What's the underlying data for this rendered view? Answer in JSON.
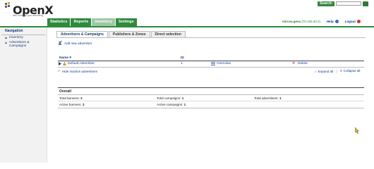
{
  "brand": {
    "name": "OpenX",
    "tagline": "take control of your advertising"
  },
  "search": {
    "label": "Search:",
    "placeholder": ""
  },
  "tabs": [
    {
      "label": "Statistics"
    },
    {
      "label": "Reports"
    },
    {
      "label": "Inventory"
    },
    {
      "label": "Settings"
    }
  ],
  "user": {
    "name": "mircea.gesu",
    "ip": "[70.150.40.2]",
    "help": "Help",
    "logout": "Logout"
  },
  "nav": {
    "title": "Navigation",
    "items": [
      {
        "label": "Inventory"
      },
      {
        "label": "Advertisers & Campaigns"
      }
    ]
  },
  "subtabs": [
    {
      "label": "Advertisers & Campaigns"
    },
    {
      "label": "Publishers & Zones"
    },
    {
      "label": "Direct selection"
    }
  ],
  "add_advertiser": "Add new advertiser",
  "table": {
    "col_name": "Name",
    "col_id": "ID",
    "rows": [
      {
        "name": "Default Advertiser",
        "id": "1",
        "overview": "Overview",
        "delete": "Delete"
      }
    ]
  },
  "hide_inactive": "Hide inactive advertisers",
  "expand_all": "Expand all",
  "collapse_all": "Collapse all",
  "overall": {
    "title": "Overall",
    "total_banners_label": "Total banners:",
    "total_banners": "2",
    "total_campaigns_label": "Total campaigns:",
    "total_campaigns": "1",
    "total_advertisers_label": "Total advertisers:",
    "total_advertisers": "1",
    "active_banners_label": "Active banners:",
    "active_banners": "2",
    "active_campaigns_label": "Active campaigns:",
    "active_campaigns": "1"
  },
  "colors": {
    "brand_green": "#2e8a3c",
    "active_tab": "#9fc8a4",
    "link_blue": "#0a3aa0"
  }
}
